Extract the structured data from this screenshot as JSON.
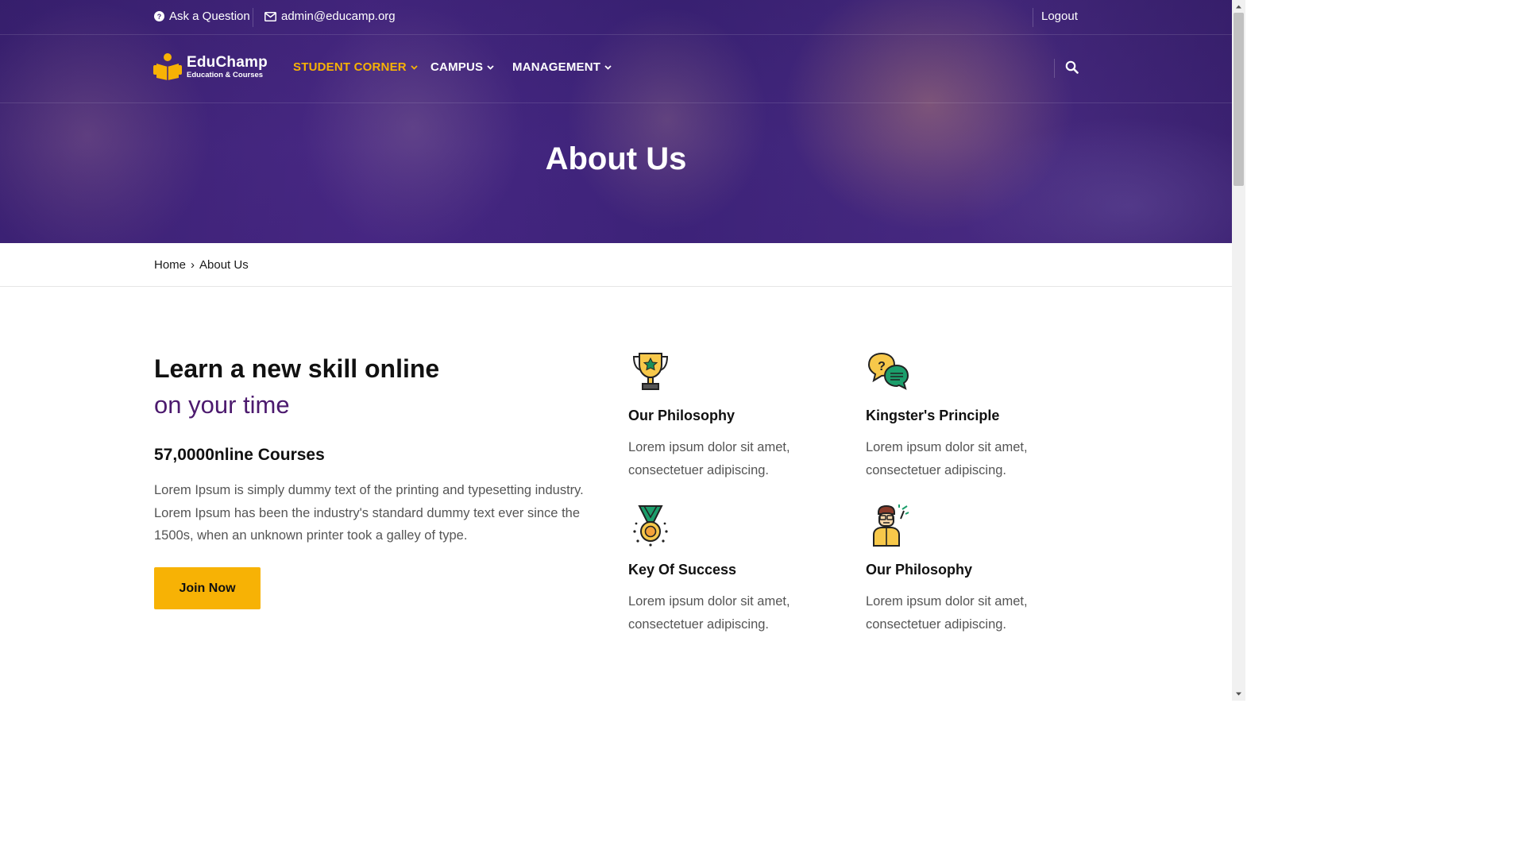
{
  "topbar": {
    "ask_label": "Ask a Question",
    "email_label": "admin@educamp.org",
    "logout_label": "Logout"
  },
  "logo": {
    "name": "EduChamp",
    "tagline": "Education & Courses"
  },
  "nav": {
    "items": [
      {
        "label": "STUDENT CORNER"
      },
      {
        "label": "CAMPUS"
      },
      {
        "label": "MANAGEMENT"
      }
    ]
  },
  "hero": {
    "title": "About Us"
  },
  "breadcrumb": {
    "home": "Home",
    "separator": "›",
    "current": "About Us"
  },
  "about": {
    "heading_line1": "Learn a new skill online",
    "heading_line2": "on your time",
    "courses": "57,0000nline Courses",
    "description": "Lorem Ipsum is simply dummy text of the printing and typesetting industry. Lorem Ipsum has been the industry's standard dummy text ever since the 1500s, when an unknown printer took a galley of type.",
    "join_label": "Join Now"
  },
  "features": [
    {
      "title": "Our Philosophy",
      "text": "Lorem ipsum dolor sit amet, consectetuer adipiscing.",
      "icon": "trophy-icon"
    },
    {
      "title": "Kingster's Principle",
      "text": "Lorem ipsum dolor sit amet, consectetuer adipiscing.",
      "icon": "chat-bubbles-icon"
    },
    {
      "title": "Key Of Success",
      "text": "Lorem ipsum dolor sit amet, consectetuer adipiscing.",
      "icon": "medal-icon"
    },
    {
      "title": "Our Philosophy",
      "text": "Lorem ipsum dolor sit amet, consectetuer adipiscing.",
      "icon": "teacher-icon"
    }
  ],
  "colors": {
    "accent": "#f7b205",
    "brand_purple": "#4c1a6e",
    "hero_overlay": "#3b2272"
  }
}
